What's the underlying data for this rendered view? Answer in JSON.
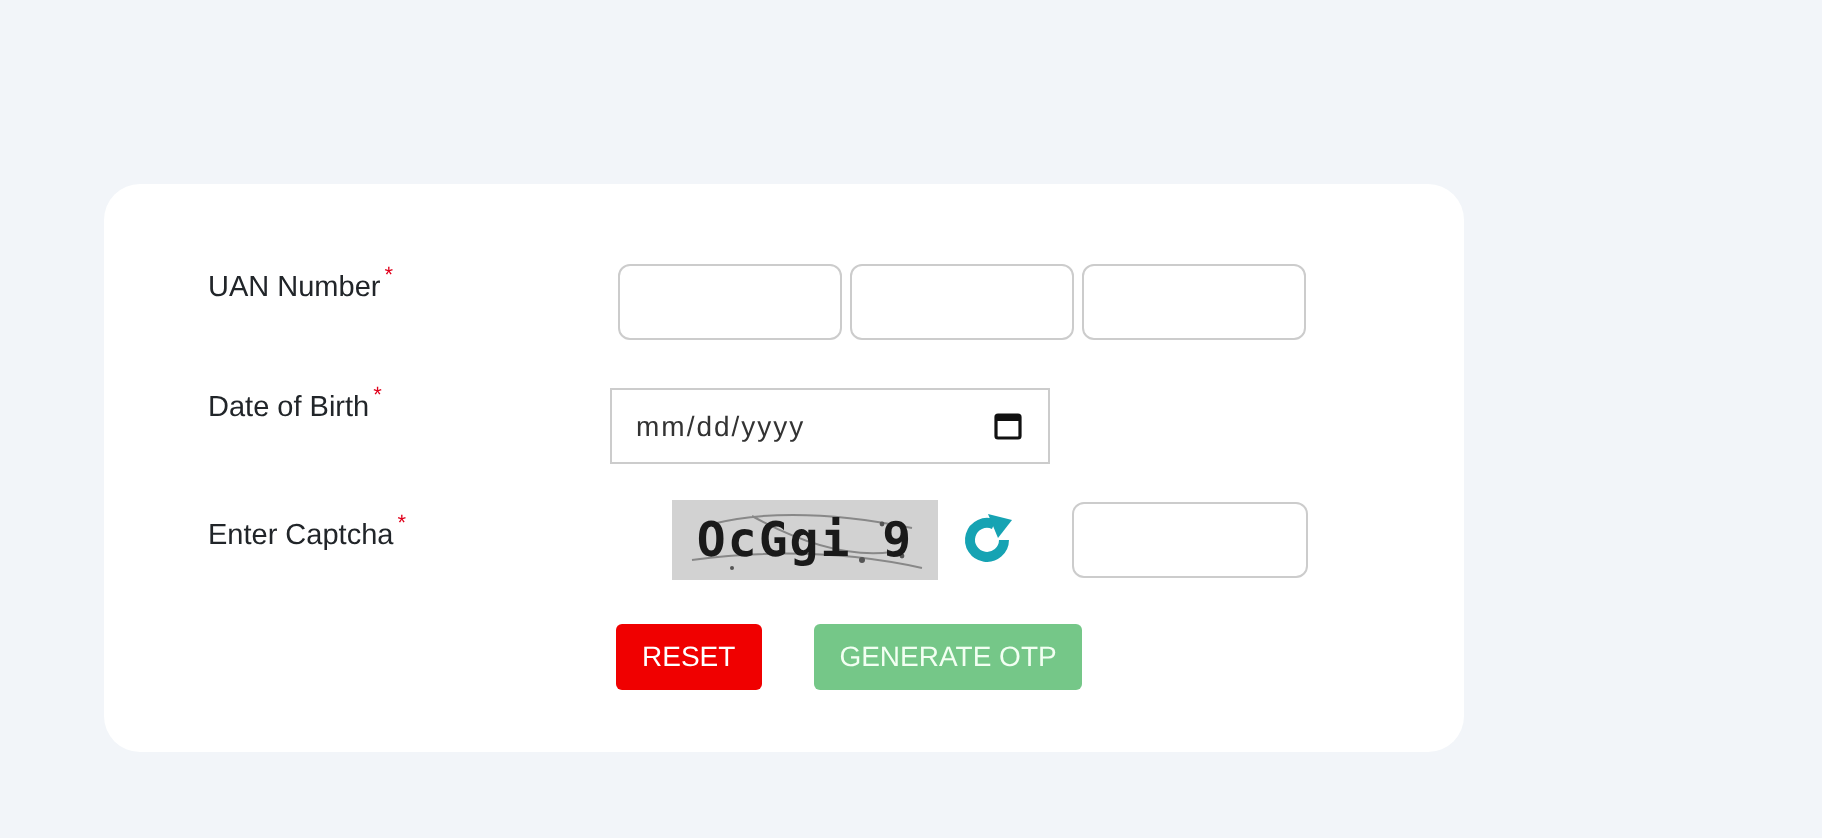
{
  "form": {
    "fields": [
      {
        "kind": "uan",
        "label": "UAN Number",
        "required_mark": "*"
      },
      {
        "kind": "date",
        "label": "Date of Birth",
        "required_mark": "*",
        "placeholder": "mm/dd/yyyy"
      },
      {
        "kind": "captcha",
        "label": "Enter Captcha",
        "required_mark": "*",
        "captcha_text": "OcGgi 9"
      }
    ],
    "buttons": [
      {
        "kind": "reset",
        "label": "RESET",
        "disabled": false
      },
      {
        "kind": "submit",
        "label": "GENERATE OTP",
        "disabled": true
      }
    ]
  }
}
